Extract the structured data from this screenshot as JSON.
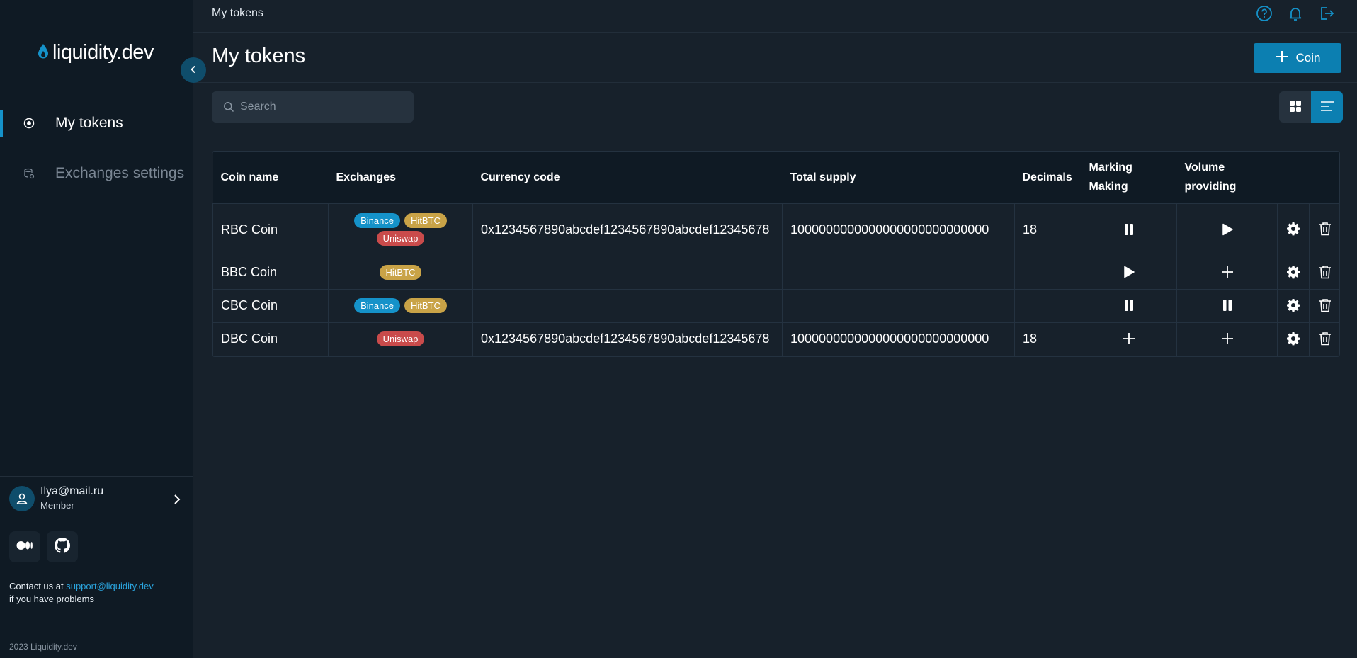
{
  "brand": {
    "name": "liquidity.dev"
  },
  "sidebar": {
    "items": [
      {
        "label": "My tokens",
        "icon": "radio-dot-icon",
        "active": true
      },
      {
        "label": "Exchanges settings",
        "icon": "exchange-settings-icon",
        "active": false
      }
    ],
    "user": {
      "email": "Ilya@mail.ru",
      "role": "Member"
    },
    "contact": {
      "prefix": "Contact us at ",
      "email": "support@liquidity.dev",
      "suffix": "if you have problems"
    },
    "copyright": "2023 Liquidity.dev"
  },
  "topbar": {
    "title": "My tokens"
  },
  "header": {
    "title": "My tokens",
    "add_button_label": "Coin"
  },
  "search": {
    "placeholder": "Search",
    "value": ""
  },
  "colors": {
    "accent": "#0c7fb1",
    "binance": "#1592c9",
    "hitbtc": "#c9a347",
    "uniswap": "#c94b4b"
  },
  "table": {
    "headers": {
      "coin_name": "Coin name",
      "exchanges": "Exchanges",
      "currency_code": "Currency code",
      "total_supply": "Total supply",
      "decimals": "Decimals",
      "marking_1": "Marking",
      "marking_2": "Making",
      "volume_1": "Volume",
      "volume_2": "providing"
    },
    "rows": [
      {
        "name": "RBC Coin",
        "exchanges": [
          "Binance",
          "HitBTC",
          "Uniswap"
        ],
        "currency_code": "0x1234567890abcdef1234567890abcdef12345678",
        "total_supply": "1000000000000000000000000000",
        "decimals": "18",
        "market_making": "pause",
        "volume_providing": "play"
      },
      {
        "name": "BBC Coin",
        "exchanges": [
          "HitBTC"
        ],
        "currency_code": "",
        "total_supply": "",
        "decimals": "",
        "market_making": "play",
        "volume_providing": "plus"
      },
      {
        "name": "CBC Coin",
        "exchanges": [
          "Binance",
          "HitBTC"
        ],
        "currency_code": "",
        "total_supply": "",
        "decimals": "",
        "market_making": "pause",
        "volume_providing": "pause"
      },
      {
        "name": "DBC Coin",
        "exchanges": [
          "Uniswap"
        ],
        "currency_code": "0x1234567890abcdef1234567890abcdef12345678",
        "total_supply": "1000000000000000000000000000",
        "decimals": "18",
        "market_making": "plus",
        "volume_providing": "plus"
      }
    ]
  }
}
